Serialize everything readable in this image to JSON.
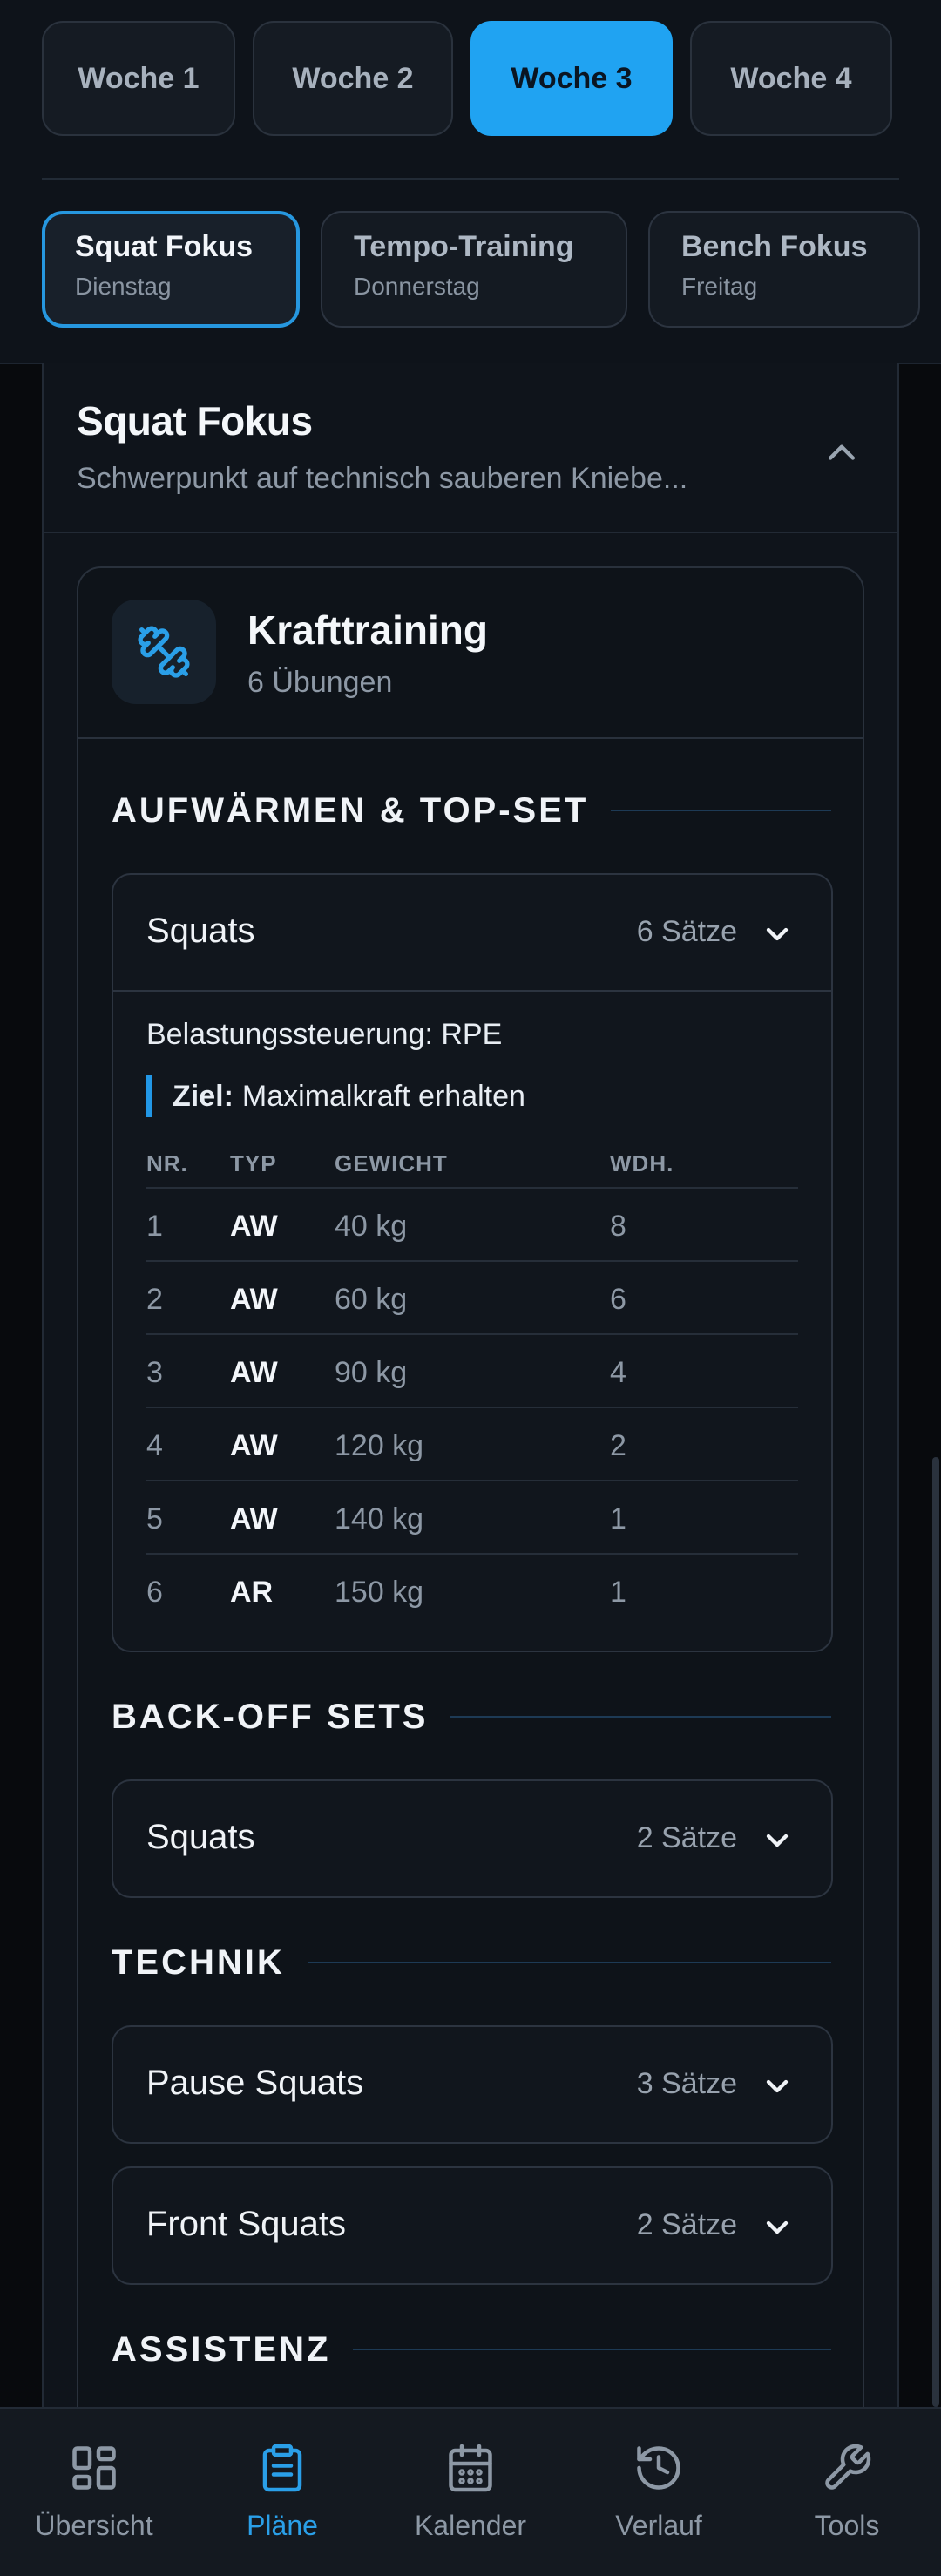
{
  "weeks": [
    "Woche 1",
    "Woche 2",
    "Woche 3",
    "Woche 4"
  ],
  "active_week": "Woche 3",
  "days": [
    {
      "title": "Squat Fokus",
      "sub": "Dienstag"
    },
    {
      "title": "Tempo-Training",
      "sub": "Donnerstag"
    },
    {
      "title": "Bench Fokus",
      "sub": "Freitag"
    }
  ],
  "plan": {
    "title": "Squat Fokus",
    "description": "Schwerpunkt auf technisch sauberen Kniebe..."
  },
  "training": {
    "title": "Krafttraining",
    "subtitle": "6 Übungen"
  },
  "sections": {
    "warmup": "AUFWÄRMEN & TOP-SET",
    "backoff": "BACK-OFF SETS",
    "technik": "TECHNIK",
    "assistenz": "ASSISTENZ"
  },
  "exercises": {
    "squats_main": {
      "name": "Squats",
      "sets": "6 Sätze"
    },
    "squats_backoff": {
      "name": "Squats",
      "sets": "2 Sätze"
    },
    "pause_squats": {
      "name": "Pause Squats",
      "sets": "3 Sätze"
    },
    "front_squats": {
      "name": "Front Squats",
      "sets": "2 Sätze"
    }
  },
  "detail": {
    "load": "Belastungssteuerung: RPE",
    "goal_label": "Ziel:",
    "goal_text": "Maximalkraft erhalten",
    "headers": [
      "NR.",
      "TYP",
      "GEWICHT",
      "WDH."
    ],
    "rows": [
      [
        "1",
        "AW",
        "40 kg",
        "8"
      ],
      [
        "2",
        "AW",
        "60 kg",
        "6"
      ],
      [
        "3",
        "AW",
        "90 kg",
        "4"
      ],
      [
        "4",
        "AW",
        "120 kg",
        "2"
      ],
      [
        "5",
        "AW",
        "140 kg",
        "1"
      ],
      [
        "6",
        "AR",
        "150 kg",
        "1"
      ]
    ]
  },
  "nav": [
    {
      "label": "Übersicht",
      "icon": "dashboard-icon"
    },
    {
      "label": "Pläne",
      "icon": "clipboard-icon"
    },
    {
      "label": "Kalender",
      "icon": "calendar-icon"
    },
    {
      "label": "Verlauf",
      "icon": "history-icon"
    },
    {
      "label": "Tools",
      "icon": "wrench-icon"
    }
  ],
  "active_nav": "Pläne",
  "colors": {
    "accent": "#20a3f2",
    "background": "#080a0d",
    "card": "#0f141b"
  }
}
